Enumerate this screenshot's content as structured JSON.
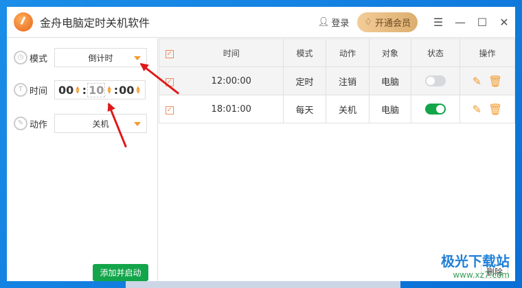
{
  "app": {
    "title": "金舟电脑定时关机软件",
    "login": "登录",
    "vip": "开通会员"
  },
  "form": {
    "mode_label": "模式",
    "mode_value": "倒计时",
    "time_label": "时间",
    "hours": "00",
    "minutes": "10",
    "seconds": "00",
    "action_label": "动作",
    "action_value": "关机",
    "add_button": "添加并启动"
  },
  "table": {
    "headers": [
      "时间",
      "模式",
      "动作",
      "对象",
      "状态",
      "操作"
    ],
    "rows": [
      {
        "time": "12:00:00",
        "mode": "定时",
        "action": "注销",
        "target": "电脑",
        "enabled": false
      },
      {
        "time": "18:01:00",
        "mode": "每天",
        "action": "关机",
        "target": "电脑",
        "enabled": true
      }
    ]
  },
  "delete_button": "删除",
  "watermark": {
    "name": "极光下载站",
    "url": "www.xz7.com"
  },
  "colors": {
    "accent": "#f39a2b",
    "green": "#12a54a"
  }
}
